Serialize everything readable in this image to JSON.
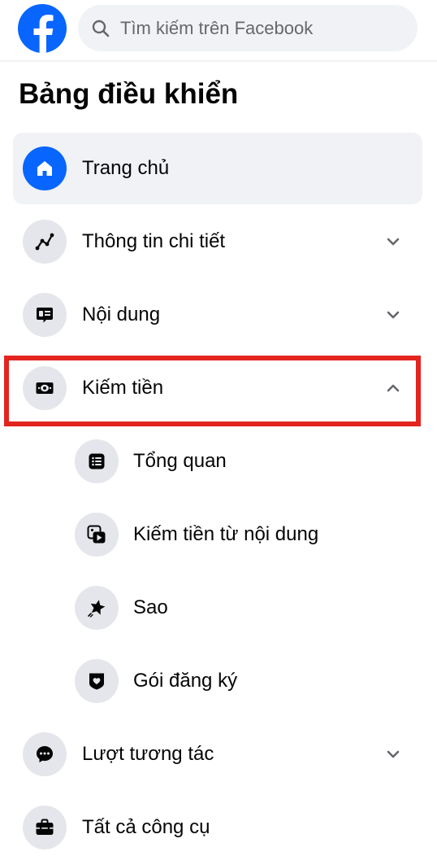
{
  "header": {
    "logo_icon": "facebook-logo",
    "search": {
      "placeholder": "Tìm kiếm trên Facebook",
      "value": "",
      "icon": "search-icon"
    }
  },
  "title": "Bảng điều khiển",
  "colors": {
    "brand": "#0866ff",
    "highlight_box": "#e3241f",
    "active_bg": "#f0f2f5",
    "icon_circle": "#e4e6eb"
  },
  "nav": [
    {
      "label": "Trang chủ",
      "icon": "home-icon",
      "active": true
    },
    {
      "label": "Thông tin chi tiết",
      "icon": "insights-chart-icon",
      "expandable": true,
      "expanded": false
    },
    {
      "label": "Nội dung",
      "icon": "content-icon",
      "expandable": true,
      "expanded": false
    },
    {
      "label": "Kiếm tiền",
      "icon": "money-icon",
      "expandable": true,
      "expanded": true,
      "highlighted": true,
      "children": [
        {
          "label": "Tổng quan",
          "icon": "list-icon"
        },
        {
          "label": "Kiếm tiền từ nội dung",
          "icon": "video-monetization-icon"
        },
        {
          "label": "Sao",
          "icon": "stars-icon"
        },
        {
          "label": "Gói đăng ký",
          "icon": "subscription-heart-icon"
        }
      ]
    },
    {
      "label": "Lượt tương tác",
      "icon": "chat-bubble-icon",
      "expandable": true,
      "expanded": false
    },
    {
      "label": "Tất cả công cụ",
      "icon": "toolbox-icon"
    }
  ]
}
